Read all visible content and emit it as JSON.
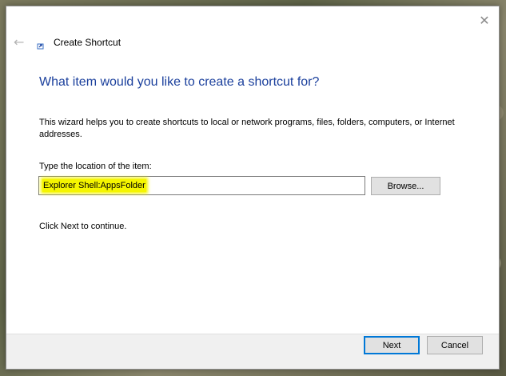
{
  "window": {
    "title": "Create Shortcut",
    "close_glyph": "✕",
    "back_glyph": "←"
  },
  "content": {
    "question": "What item would you like to create a shortcut for?",
    "intro": "This wizard helps you to create shortcuts to local or network programs, files, folders, computers, or Internet addresses.",
    "location_label": "Type the location of the item:",
    "location_value": "Explorer Shell:AppsFolder",
    "browse_label": "Browse...",
    "continue_hint": "Click Next to continue."
  },
  "footer": {
    "next_label": "Next",
    "cancel_label": "Cancel"
  },
  "colors": {
    "question_text": "#1a3f9c",
    "highlight": "#f5f500",
    "default_button_border": "#0078d7"
  },
  "icons": {
    "back": "back-arrow-icon",
    "close": "close-icon",
    "wizard": "shortcut-wizard-icon"
  }
}
